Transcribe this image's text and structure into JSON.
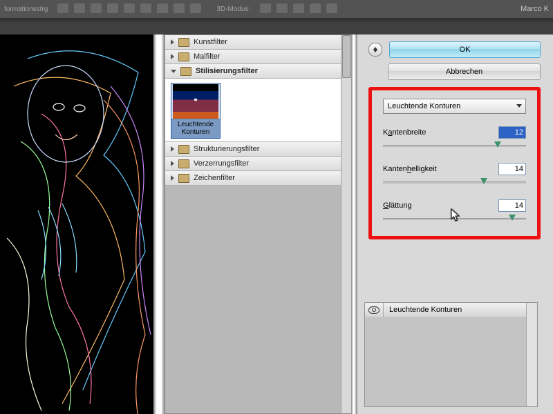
{
  "topbar": {
    "left_label": "formationsstrg",
    "mode_label": "3D-Modus:",
    "right_label": "Marco K"
  },
  "tree": {
    "items": [
      {
        "label": "Kunstfilter",
        "open": false
      },
      {
        "label": "Malfilter",
        "open": false
      },
      {
        "label": "Stilisierungsfilter",
        "open": true,
        "selected": true
      },
      {
        "label": "Strukturierungsfilter",
        "open": false
      },
      {
        "label": "Verzerrungsfilter",
        "open": false
      },
      {
        "label": "Zeichenfilter",
        "open": false
      }
    ],
    "thumb": {
      "line1": "Leuchtende",
      "line2": "Konturen"
    }
  },
  "buttons": {
    "ok": "OK",
    "cancel": "Abbrechen"
  },
  "dropdown": {
    "value": "Leuchtende Konturen"
  },
  "sliders": [
    {
      "label_pre": "K",
      "label_u": "a",
      "label_post": "ntenbreite",
      "value": "12",
      "value_selected": true,
      "knob_pct": 78
    },
    {
      "label_pre": "Kanten",
      "label_u": "h",
      "label_post": "elligkeit",
      "value": "14",
      "value_selected": false,
      "knob_pct": 68
    },
    {
      "label_pre": "",
      "label_u": "G",
      "label_post": "lättung",
      "value": "14",
      "value_selected": false,
      "knob_pct": 88
    }
  ],
  "layers": {
    "title": "Leuchtende Konturen"
  }
}
